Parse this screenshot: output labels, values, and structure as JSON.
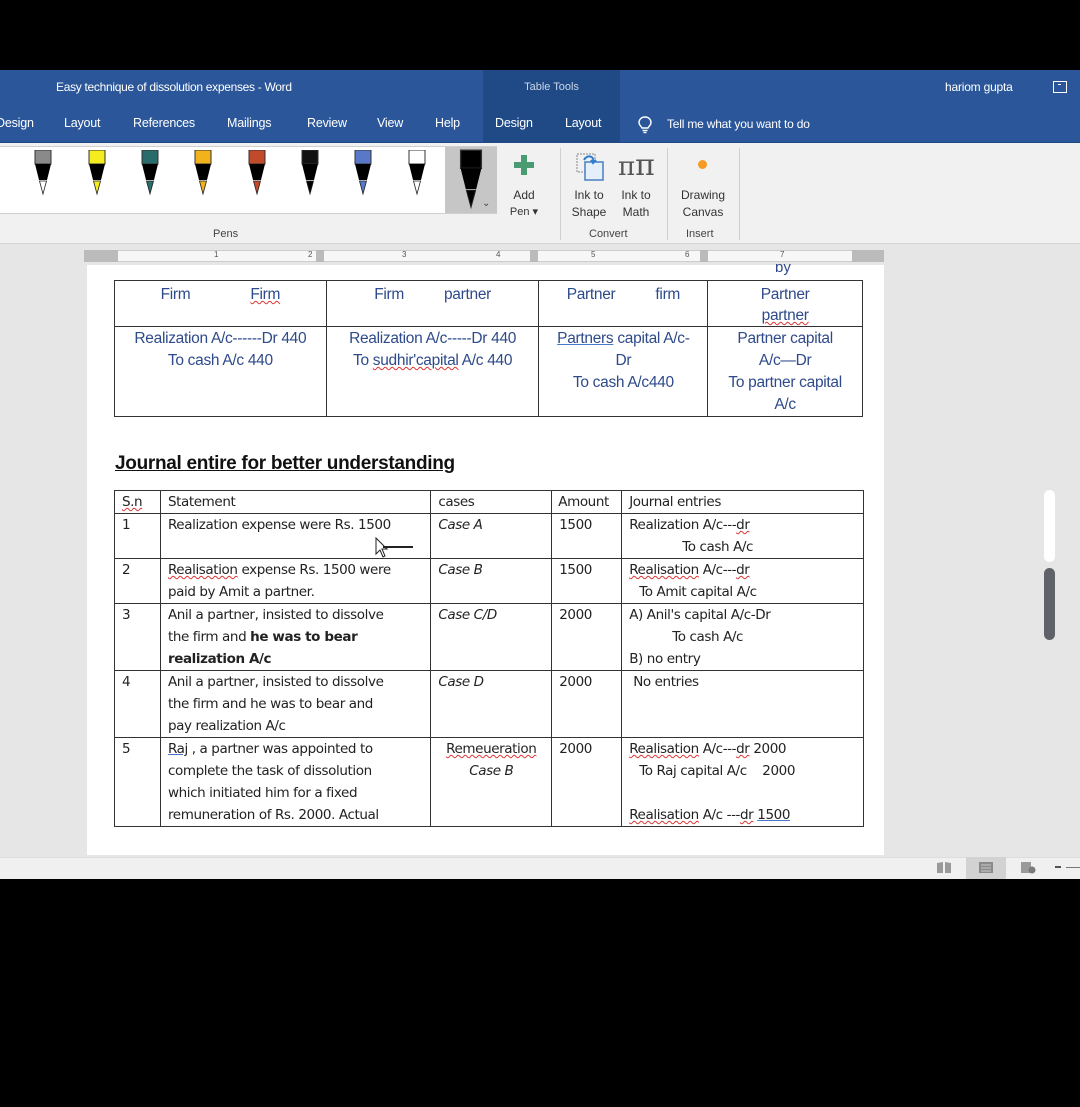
{
  "window": {
    "title": "Easy technique  of dissolution expenses  -  Word",
    "context_label": "Table Tools",
    "user": "hariom gupta"
  },
  "tabs": [
    {
      "label": "Design"
    },
    {
      "label": "Layout"
    },
    {
      "label": "References"
    },
    {
      "label": "Mailings"
    },
    {
      "label": "Review"
    },
    {
      "label": "View"
    },
    {
      "label": "Help"
    },
    {
      "label": "Design"
    },
    {
      "label": "Layout"
    }
  ],
  "tell_me": "Tell me what you want to do",
  "ribbon": {
    "pens_group": "Pens",
    "pens": [
      {
        "name": "gray-pencil",
        "color": "#8a8a8a"
      },
      {
        "name": "yellow-highlighter",
        "color": "#f5ec1f"
      },
      {
        "name": "teal-galaxy-pen",
        "color": "#2a6b6b"
      },
      {
        "name": "gold-pen",
        "color": "#f2b21b"
      },
      {
        "name": "rainbow-pen",
        "color": "#c04a2a"
      },
      {
        "name": "black-pencil",
        "color": "#111111"
      },
      {
        "name": "ocean-pen",
        "color": "#5a78c8"
      },
      {
        "name": "white-pen",
        "color": "#ffffff"
      },
      {
        "name": "black-pen-selected",
        "color": "#000000"
      }
    ],
    "add_pen": [
      "Add",
      "Pen ▾"
    ],
    "ink_to_shape": [
      "Ink to",
      "Shape"
    ],
    "ink_to_math": [
      "Ink to",
      "Math"
    ],
    "convert_group": "Convert",
    "drawing_canvas": [
      "Drawing",
      "Canvas"
    ],
    "insert_group": "Insert"
  },
  "ruler": {
    "numbers": [
      "1",
      "2",
      "3",
      "4",
      "5",
      "6",
      "7"
    ]
  },
  "table1": {
    "cutoff_text": "by",
    "header": [
      [
        "Firm",
        "Firm"
      ],
      [
        "Firm",
        "partner"
      ],
      [
        "Partner",
        "firm"
      ],
      [
        "Partner",
        "partner"
      ]
    ],
    "row": [
      [
        "Realization A/c------Dr 440",
        "To cash A/c 440"
      ],
      [
        "Realization A/c-----Dr 440",
        "To ",
        "sudhir'capital",
        " A/c 440"
      ],
      [
        "Partners",
        " capital A/c-",
        "Dr",
        "To cash A/c440"
      ],
      [
        "Partner capital",
        "A/c—Dr",
        "To partner capital",
        "A/c"
      ]
    ]
  },
  "heading": "Journal entire for better understanding",
  "table2": {
    "columns": [
      "S.n",
      "Statement",
      "cases",
      "Amount",
      "Journal entries"
    ],
    "rows": [
      {
        "sn": "1",
        "statement": [
          "Realization expense were Rs. 1500"
        ],
        "case": "Case A",
        "amount": "1500",
        "entries": [
          "Realization A/c---",
          "dr",
          "To cash A/c"
        ]
      },
      {
        "sn": "2",
        "statement": [
          "Realisation",
          " expense Rs. 1500 were",
          "paid by Amit a partner."
        ],
        "case": "Case B",
        "amount": "1500",
        "entries": [
          "Realisation",
          " A/c---",
          "dr",
          "To Amit capital A/c"
        ]
      },
      {
        "sn": "3",
        "statement": [
          "Anil a partner, insisted to dissolve",
          "the firm and ",
          "he was to bear",
          "realization A/c"
        ],
        "case": "Case C/D",
        "amount": "2000",
        "entries": [
          "A) Anil's capital A/c-Dr",
          "To cash A/c",
          "B) no entry"
        ]
      },
      {
        "sn": "4",
        "statement": [
          "Anil a partner, insisted to dissolve",
          "the firm and he was to bear and",
          "pay realization A/c"
        ],
        "case": "Case D",
        "amount": "2000",
        "entries": [
          "No entries"
        ]
      },
      {
        "sn": "5",
        "statement": [
          "Raj",
          " , a partner was appointed to",
          "complete the task of dissolution",
          "which initiated him for a fixed",
          "remuneration of Rs. 2000. Actual"
        ],
        "case": [
          "Remeueration",
          "Case  B"
        ],
        "amount": "2000",
        "entries": [
          "Realisation",
          " A/c---",
          "dr",
          " 2000",
          "To Raj capital A/c    2000",
          "Realisation",
          " A/c ---",
          "dr",
          "1500"
        ]
      }
    ]
  },
  "statusbar": {
    "views": [
      "read-mode",
      "print-layout",
      "web-layout"
    ],
    "active_view": "print-layout"
  },
  "scrollbar": {
    "position_fraction": 0.55
  }
}
